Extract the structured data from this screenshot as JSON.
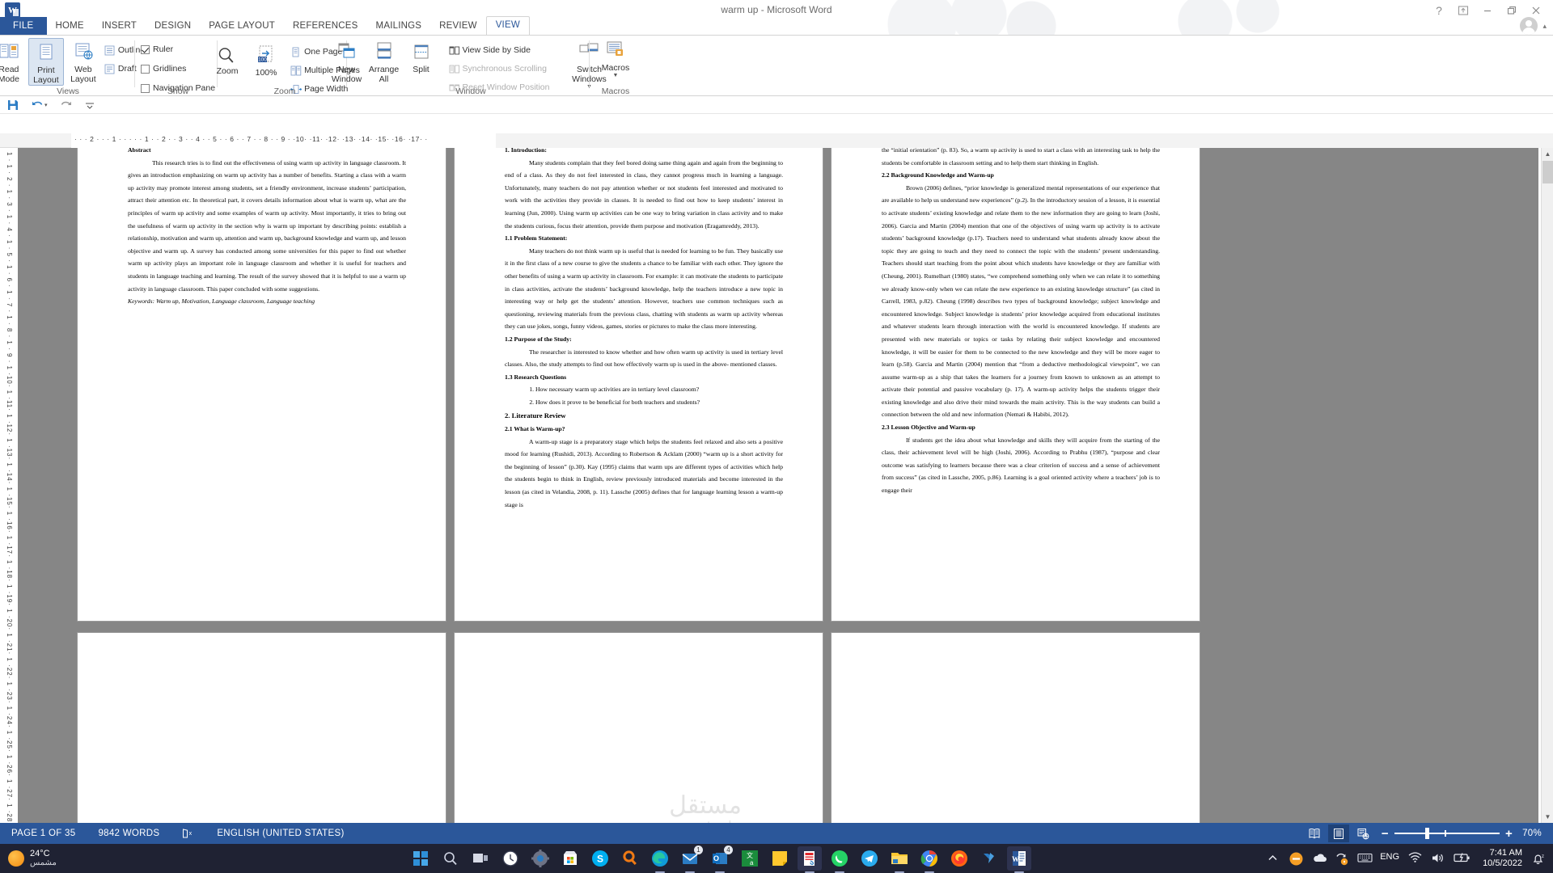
{
  "window": {
    "title": "warm up - Microsoft Word",
    "app_icon": "word-icon",
    "controls": {
      "help": "?",
      "ribbon_display": "ribbon-display-options-icon",
      "minimize": "minimize-icon",
      "restore": "restore-icon",
      "close": "close-icon"
    }
  },
  "ribbon": {
    "tabs": [
      {
        "label": "FILE",
        "active": false
      },
      {
        "label": "HOME",
        "active": false
      },
      {
        "label": "INSERT",
        "active": false
      },
      {
        "label": "DESIGN",
        "active": false
      },
      {
        "label": "PAGE LAYOUT",
        "active": false
      },
      {
        "label": "REFERENCES",
        "active": false
      },
      {
        "label": "MAILINGS",
        "active": false
      },
      {
        "label": "REVIEW",
        "active": false
      },
      {
        "label": "VIEW",
        "active": true
      }
    ],
    "groups": [
      {
        "name": "Views",
        "label": "Views",
        "buttons": [
          {
            "label": "Read Mode",
            "icon": "read-mode-icon",
            "selected": false
          },
          {
            "label": "Print Layout",
            "icon": "print-layout-icon",
            "selected": true
          },
          {
            "label": "Web Layout",
            "icon": "web-layout-icon",
            "selected": false
          }
        ],
        "items": [
          {
            "label": "Outline",
            "icon": "outline-icon"
          },
          {
            "label": "Draft",
            "icon": "draft-icon"
          }
        ]
      },
      {
        "name": "Show",
        "label": "Show",
        "checkboxes": [
          {
            "label": "Ruler",
            "checked": true
          },
          {
            "label": "Gridlines",
            "checked": false
          },
          {
            "label": "Navigation Pane",
            "checked": false
          }
        ]
      },
      {
        "name": "Zoom",
        "label": "Zoom",
        "buttons": [
          {
            "label": "Zoom",
            "icon": "magnifier-icon"
          },
          {
            "label": "100%",
            "icon": "zoom-100-icon"
          }
        ],
        "items": [
          {
            "label": "One Page",
            "icon": "one-page-icon"
          },
          {
            "label": "Multiple Pages",
            "icon": "multiple-pages-icon"
          },
          {
            "label": "Page Width",
            "icon": "page-width-icon"
          }
        ]
      },
      {
        "name": "Window",
        "label": "Window",
        "buttons": [
          {
            "label": "New Window",
            "icon": "new-window-icon"
          },
          {
            "label": "Arrange All",
            "icon": "arrange-all-icon"
          },
          {
            "label": "Split",
            "icon": "split-icon"
          }
        ],
        "items": [
          {
            "label": "View Side by Side",
            "icon": "view-side-by-side-icon",
            "disabled": false
          },
          {
            "label": "Synchronous Scrolling",
            "icon": "synchronous-scrolling-icon",
            "disabled": true
          },
          {
            "label": "Reset Window Position",
            "icon": "reset-window-position-icon",
            "disabled": true
          }
        ],
        "dropdown": {
          "label": "Switch Windows",
          "icon": "switch-windows-icon"
        }
      },
      {
        "name": "Macros",
        "label": "Macros",
        "buttons": [
          {
            "label": "Macros",
            "icon": "macros-icon"
          }
        ]
      }
    ]
  },
  "quick_access": {
    "items": [
      {
        "name": "save-icon",
        "label": "Save"
      },
      {
        "name": "undo-icon",
        "label": "Undo"
      },
      {
        "name": "redo-icon",
        "label": "Redo"
      },
      {
        "name": "customize-qat-icon",
        "label": "Customize Quick Access Toolbar"
      }
    ]
  },
  "ruler": {
    "horizontal": "·  ·  · 2 ·  ·  · 1 ·  ·  ·    ·  · 1 ·  · 2 ·  · 3 ·  · 4 ·  · 5 ·  · 6 ·  · 7 ·  · 8 ·  · 9 ·  ·10·  ·11·  ·12·  ·13·  ·14·  ·15·  ·16·  ·17·  ·",
    "vertical": "1 · 1 · 2 · 1 · 3 · 1 · 4 · 1 · 5 · 1 · 6 · 1 · 7 · 1 · 8 · 1 · 9 · 1 ·10· 1 ·11· 1 ·12· 1 ·13· 1 ·14· 1 ·15· 1 ·16· 1 ·17· 1 ·18· 1 ·19· 1 ·20· 1 ·21· 1 ·22· 1 ·23· 1 ·24· 1 ·25· 1 ·26· 1 ·27· 1 ·28·"
  },
  "document": {
    "watermark": {
      "arabic": "مستقل",
      "latin": "mostaql"
    },
    "pages": [
      {
        "id": "page-1",
        "blocks": [
          {
            "type": "heading",
            "text": "Abstract"
          },
          {
            "type": "para",
            "indent": true,
            "text": "This research tries is to find out the effectiveness of using warm up activity in language classroom. It gives an introduction emphasizing on warm up activity has a number of benefits. Starting a class with a warm up activity may promote interest among students, set a friendly environment, increase students’ participation, attract their attention etc. In theoretical part, it covers details information about what is warm up, what are the principles of warm up activity and some examples of warm up activity. Most importantly, it tries to bring out the usefulness of warm up activity in the section why is warm up important by describing points: establish a relationship, motivation and warm up, attention and warm up, background knowledge and warm up, and lesson objective and warm up. A survey has conducted among some universities for this paper to find out whether warm up activity plays an important role in language classroom and whether it is useful for teachers and students in language teaching and learning. The result of the survey showed that it is helpful to use a warm up activity in language classroom. This paper concluded with some suggestions."
          },
          {
            "type": "keywords",
            "text": "Keywords: Warm up, Motivation, Language classroom, Language teaching"
          }
        ]
      },
      {
        "id": "page-2",
        "blocks": [
          {
            "type": "heading",
            "text": "1. Introduction:"
          },
          {
            "type": "para",
            "indent": true,
            "text": "Many students complain that they feel bored doing same thing again and again from the beginning to end of a class. As they do not feel interested in class, they cannot progress much in learning a language. Unfortunately, many teachers do not pay attention whether or not students feel interested and motivated to work with the activities they provide in classes. It is needed to find out how to keep students’ interest in learning (Jun, 2000). Using warm up activities can be one way to bring variation in class activity and to make the students curious, focus their attention, provide them purpose and motivation (Eragamreddy, 2013)."
          },
          {
            "type": "heading",
            "text": "1.1 Problem Statement:"
          },
          {
            "type": "para",
            "indent": true,
            "text": "Many teachers do not think warm up is useful that is needed for learning to be fun. They basically use it in the first class of a new course to give the students a chance to be familiar with each other. They ignore the other benefits of using a warm up activity in classroom. For example: it can motivate the students to participate in class activities, activate the students’ background knowledge, help the teachers introduce a new topic in interesting way or help get the students’ attention. However, teachers use common techniques such as questioning, reviewing materials from the previous class, chatting with students as warm up activity whereas they can use jokes, songs, funny videos, games, stories or pictures to make the class more interesting."
          },
          {
            "type": "heading",
            "text": "1.2 Purpose of the Study:"
          },
          {
            "type": "para",
            "indent": true,
            "text": "The researcher is interested to know whether and how often warm up activity is used in tertiary level classes. Also, the study attempts to find out how effectively warm up is used in the above- mentioned classes."
          },
          {
            "type": "heading",
            "text": "1.3 Research Questions"
          },
          {
            "type": "list",
            "items": [
              "How necessary warm up activities are in tertiary level classroom?",
              "How does it prove to be beneficial for both teachers and students?"
            ]
          },
          {
            "type": "heading",
            "text": "2. Literature Review"
          },
          {
            "type": "heading",
            "text": "2.1 What is Warm-up?"
          },
          {
            "type": "para",
            "indent": true,
            "text": "A warm-up stage is a preparatory stage which helps the students feel relaxed and also sets a positive mood for learning (Rushidi, 2013). According to Robertson & Acklam (2000) “warm up is a short activity for the beginning of lesson” (p.30). Kay (1995) claims that warm ups are different types of activities which help the students begin to think in English, review previously introduced materials and become interested in the lesson (as cited in Velandia, 2008, p. 11). Lassche (2005) defines that for language learning lesson a warm-up stage is"
          }
        ]
      },
      {
        "id": "page-3",
        "blocks": [
          {
            "type": "para",
            "indent": false,
            "text": "the “initial orientation” (p. 83). So, a warm up activity is used to start a class with an interesting task to help the students be comfortable in classroom setting and to help them start thinking in English."
          },
          {
            "type": "heading",
            "text": "2.2 Background Knowledge and Warm-up"
          },
          {
            "type": "para",
            "indent": true,
            "text": "Brown (2006) defines, “prior knowledge is generalized mental representations of our experience that are available to help us understand new experiences” (p.2). In the introductory session of a lesson, it is essential to activate students’ existing knowledge and relate them to the new information they are going to learn (Joshi, 2006). Garcia and Martin (2004) mention that one of the objectives of using warm up activity is to activate students’ background knowledge (p.17). Teachers need to understand what students already know about the topic they are going to teach and they need to connect the topic with the students’ present understanding. Teachers should start teaching from the point about which students have knowledge or they are familiar with (Cheung, 2001). Rumelhart (1980) states, “we comprehend something only when we can relate it to something we already know-only when we can relate the new experience to an existing knowledge structure” (as cited in Carrell, 1983, p.82). Cheung (1998) describes two types of background knowledge; subject knowledge and encountered knowledge. Subject knowledge is students’ prior knowledge acquired from educational institutes and whatever students learn through interaction with the world is encountered knowledge. If students are presented with new materials or topics or tasks by relating their subject knowledge and encountered knowledge, it will be easier for them to be connected to the new knowledge and they will be more eager to learn (p.58). Garcia and Martin (2004) mention that “from a deductive methodological viewpoint”, we can assume warm-up as a ship that takes the learners for a journey from known to unknown as an attempt to activate their potential and passive vocabulary (p. 17). A warm-up activity helps the students trigger their existing knowledge and also drive their mind towards the main activity. This is the way students can build a connection between the old and new information (Nemati & Habibi, 2012)."
          },
          {
            "type": "heading",
            "text": "2.3 Lesson Objective and Warm-up"
          },
          {
            "type": "para",
            "indent": true,
            "text": "If students get the idea about what knowledge and skills they will acquire from the starting of the class, their achievement level will be high (Joshi, 2006). According to Prabhu (1987), “purpose and clear outcome was satisfying to learners because there was a clear criterion of success and a sense of achievement from success” (as cited in Lassche, 2005, p.86). Learning is a goal oriented activity where a teachers’ job is to engage their"
          }
        ]
      }
    ]
  },
  "status_bar": {
    "page": "PAGE 1 OF 35",
    "words": "9842 WORDS",
    "proofing_icon": "proofing-errors-icon",
    "language": "ENGLISH (UNITED STATES)",
    "view_modes": [
      {
        "name": "read-mode-view-icon",
        "selected": false
      },
      {
        "name": "print-layout-view-icon",
        "selected": true
      },
      {
        "name": "web-layout-view-icon",
        "selected": false
      }
    ],
    "zoom_out": "−",
    "zoom_in": "+",
    "zoom_level": "70%"
  },
  "taskbar": {
    "weather": {
      "temp": "24°C",
      "desc": "مشمس",
      "icon": "sun-icon"
    },
    "apps": [
      {
        "name": "start-button-icon",
        "label": "Start"
      },
      {
        "name": "search-icon",
        "label": "Search"
      },
      {
        "name": "task-view-icon",
        "label": "Task View"
      },
      {
        "name": "clock-app-icon",
        "label": "Clock"
      },
      {
        "name": "settings-icon",
        "label": "Settings"
      },
      {
        "name": "microsoft-store-icon",
        "label": "Microsoft Store"
      },
      {
        "name": "skype-icon",
        "label": "Skype"
      },
      {
        "name": "cortana-icon",
        "label": "Cortana"
      },
      {
        "name": "edge-icon",
        "label": "Microsoft Edge"
      },
      {
        "name": "mail-icon",
        "label": "Mail",
        "badge": "1"
      },
      {
        "name": "outlook-icon",
        "label": "Outlook",
        "badge": "4"
      },
      {
        "name": "translator-icon",
        "label": "Translator"
      },
      {
        "name": "sticky-notes-icon",
        "label": "Sticky Notes"
      },
      {
        "name": "pdf-reader-icon",
        "label": "PDF Reader"
      },
      {
        "name": "whatsapp-icon",
        "label": "WhatsApp"
      },
      {
        "name": "telegram-icon",
        "label": "Telegram"
      },
      {
        "name": "file-explorer-icon",
        "label": "File Explorer"
      },
      {
        "name": "chrome-icon",
        "label": "Google Chrome"
      },
      {
        "name": "firefox-icon",
        "label": "Mozilla Firefox"
      },
      {
        "name": "yandex-icon",
        "label": "Yandex"
      },
      {
        "name": "word-taskbar-icon",
        "label": "Microsoft Word"
      }
    ],
    "tray": [
      {
        "name": "show-hidden-icons-icon",
        "label": "Show hidden icons"
      },
      {
        "name": "tray-app-orange-icon",
        "label": "Tray app"
      },
      {
        "name": "onedrive-icon",
        "label": "OneDrive"
      },
      {
        "name": "update-icon",
        "label": "Updates"
      },
      {
        "name": "keyboard-icon",
        "label": "Keyboard"
      },
      {
        "name": "language-indicator",
        "label": "ENG"
      },
      {
        "name": "wifi-icon",
        "label": "Network"
      },
      {
        "name": "volume-icon",
        "label": "Volume"
      },
      {
        "name": "battery-icon",
        "label": "Battery"
      },
      {
        "name": "notifications-icon",
        "label": "Notifications"
      }
    ],
    "clock": {
      "time": "7:41 AM",
      "date": "10/5/2022"
    }
  }
}
